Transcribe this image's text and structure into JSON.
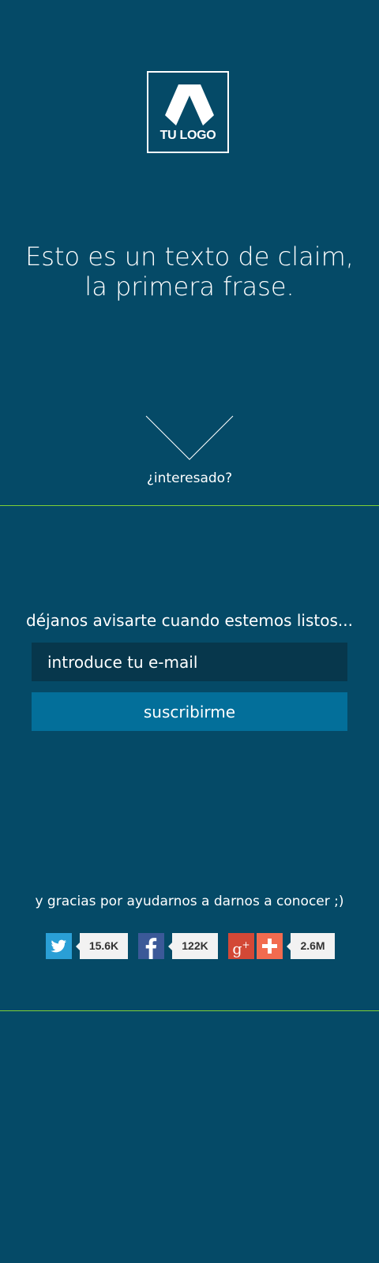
{
  "logo": {
    "text": "TU LOGO",
    "icon": "logo-mark-icon"
  },
  "claim": {
    "line1": "Esto es un texto de claim,",
    "line2": "la primera frase."
  },
  "scroll": {
    "icon": "chevron-down-icon",
    "label": "¿interesado?"
  },
  "signup": {
    "prompt": "déjanos avisarte cuando estemos listos...",
    "email_placeholder": "introduce tu e-mail",
    "button_label": "suscribirme"
  },
  "share": {
    "thanks": "y gracias por ayudarnos a darnos a conocer ;)",
    "items": [
      {
        "network": "twitter",
        "icon": "twitter-icon",
        "count": "15.6K",
        "color": "#2a9fd6"
      },
      {
        "network": "facebook",
        "icon": "facebook-icon",
        "count": "122K",
        "color": "#3b5998"
      },
      {
        "network": "google-plus",
        "icon": "google-plus-icon",
        "count": "2.6M",
        "color": "#d34836"
      }
    ],
    "plus_icon": "plus-icon"
  },
  "colors": {
    "background": "#054a67",
    "input_background": "#07374c",
    "button_background": "#036f9a",
    "divider": "#7fcf35"
  }
}
